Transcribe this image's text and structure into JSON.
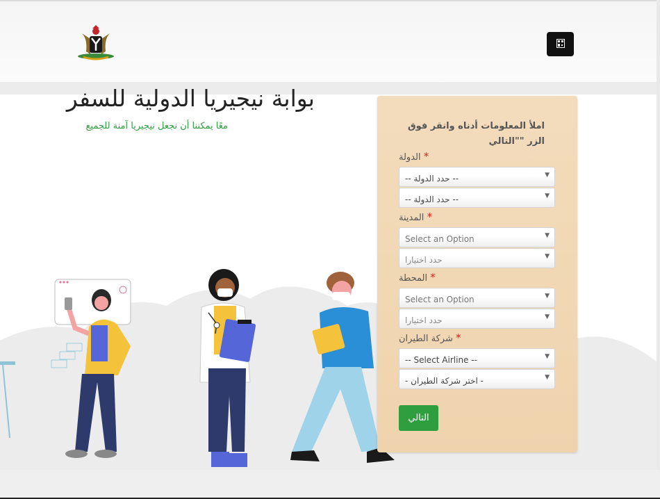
{
  "header": {
    "logo_alt": "coat-of-arms",
    "menu_icon": "qr-menu-icon"
  },
  "hero": {
    "title": "بوابة نيجيريا الدولية للسفر",
    "subtitle": "معًا يمكننا أن نجعل نيجيريا آمنة للجميع"
  },
  "form": {
    "title": "املأ المعلومات أدناه وانقر فوق الزر \"\"التالي",
    "required_mark": "*",
    "country": {
      "label": "الدولة",
      "select1": "-- حدد الدولة --",
      "select2": "-- حدد الدولة --"
    },
    "city": {
      "label": "المدينة",
      "select1": "Select an Option",
      "select2": "حدد اختيارا"
    },
    "station": {
      "label": "المحطة",
      "select1": "Select an Option",
      "select2": "حدد اختيارا"
    },
    "airline": {
      "label": "شركة الطيران",
      "select1": "-- Select Airline --",
      "select2": "- اختر شركة الطيران -"
    },
    "next_label": "التالي"
  },
  "colors": {
    "accent_green": "#2e9e3e",
    "card_bg": "#f3dcbc",
    "required_red": "#e02020"
  }
}
